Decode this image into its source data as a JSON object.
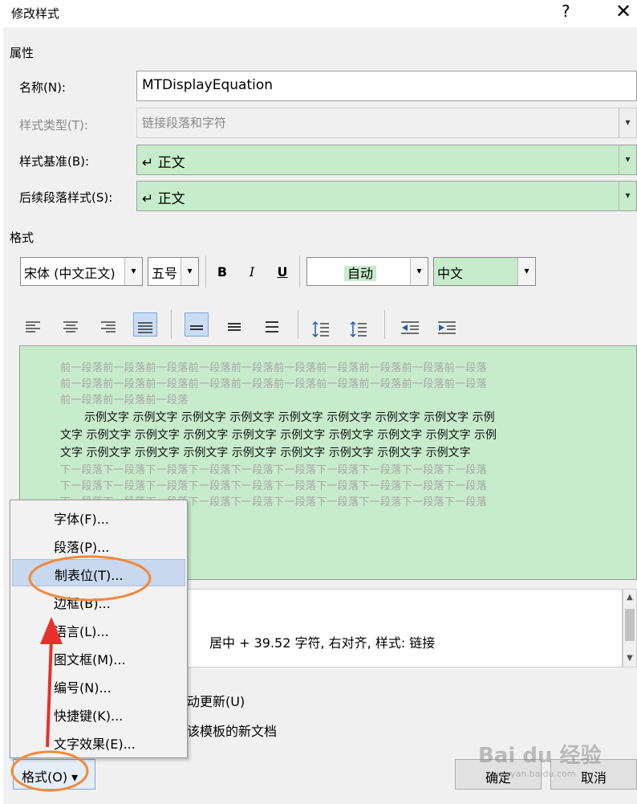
{
  "dialog": {
    "title": "修改样式",
    "help": "?",
    "close": "✕"
  },
  "properties": {
    "section": "属性",
    "name_label": "名称(N):",
    "name_value": "MTDisplayEquation",
    "style_type_label": "样式类型(T):",
    "style_type_value": "链接段落和字符",
    "style_based_label": "样式基准(B):",
    "style_based_value": "↵ 正文",
    "next_style_label": "后续段落样式(S):",
    "next_style_value": "↵ 正文"
  },
  "format": {
    "section": "格式",
    "font": "宋体 (中文正文)",
    "size": "五号",
    "bold": "B",
    "italic": "I",
    "underline": "U",
    "color": "自动",
    "language": "中文"
  },
  "preview": {
    "prev_line1": "前一段落前一段落前一段落前一段落前一段落前一段落前一段落前一段落前一段落前一段落",
    "prev_line2": "前一段落前一段落前一段落前一段落前一段落前一段落前一段落前一段落前一段落前一段落",
    "prev_line3": "前一段落前一段落前一段落",
    "sample_line1": "示例文字 示例文字 示例文字 示例文字 示例文字 示例文字 示例文字 示例文字 示例",
    "sample_line2": "文字 示例文字 示例文字 示例文字 示例文字 示例文字 示例文字 示例文字 示例文字 示例",
    "sample_line3": "文字 示例文字 示例文字 示例文字 示例文字 示例文字 示例文字 示例文字 示例文字",
    "next_line1": "下一段落下一段落下一段落下一段落下一段落下一段落下一段落下一段落下一段落下一段落",
    "next_line2": "下一段落下一段落下一段落下一段落下一段落下一段落下一段落下一段落下一段落下一段落",
    "next_line3": "下一段落下一段落下一段落下一段落下一段落下一段落下一段落下一段落下一段落下一段落"
  },
  "description": {
    "text": "居中 +  39.52 字符, 右对齐, 样式: 链接"
  },
  "options": {
    "auto_update": "动更新(U)",
    "new_docs": "该模板的新文档"
  },
  "menu": {
    "items": [
      "字体(F)...",
      "段落(P)...",
      "制表位(T)...",
      "边框(B)...",
      "语言(L)...",
      "图文框(M)...",
      "编号(N)...",
      "快捷键(K)...",
      "文字效果(E)..."
    ]
  },
  "buttons": {
    "format": "格式(O) ▾",
    "ok": "确定",
    "cancel": "取消"
  },
  "watermark": {
    "brand": "Bai du 经验",
    "url": "jingyan.baidu.com"
  },
  "colors": {
    "preview_bg": "#c7eccb",
    "highlight": "#c7d8ef",
    "annotation": "#f08a3c",
    "arrow": "#e8302a"
  }
}
